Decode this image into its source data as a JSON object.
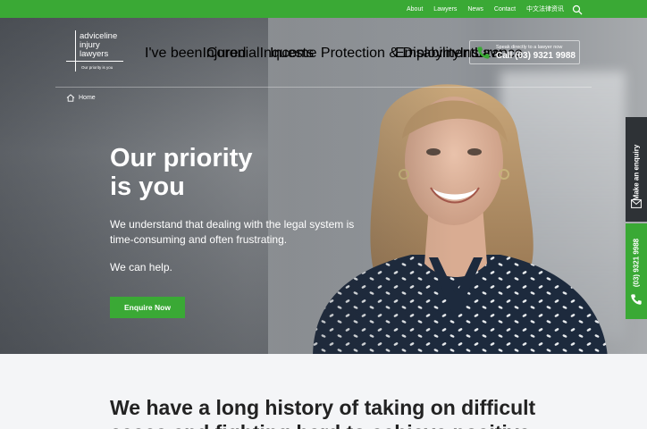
{
  "topbar": {
    "links": [
      "About",
      "Lawyers",
      "News",
      "Contact",
      "中文法律资讯"
    ],
    "search_icon": "search-icon"
  },
  "logo": {
    "line1": "adviceline",
    "line2": "injury",
    "line3": "lawyers",
    "tagline": "Our priority is you"
  },
  "nav": {
    "items": [
      {
        "line1": "I've been",
        "line2": "Injured"
      },
      {
        "line1": "Coronial",
        "line2": "Inquests"
      },
      {
        "line1": "Income Protection & Disability",
        "line2": "Insurance"
      },
      {
        "line1": "Employment",
        "line2": "Law"
      }
    ]
  },
  "call": {
    "small": "Speak directly to a lawyer now",
    "number": "Call (03) 9321 9988",
    "icon": "phone-icon"
  },
  "breadcrumb": {
    "home": "Home",
    "icon": "home-icon"
  },
  "hero": {
    "title_line1": "Our priority",
    "title_line2": "is you",
    "para1": "We understand that dealing with the legal system is time-consuming and often frustrating.",
    "para2": "We can help.",
    "cta": "Enquire Now"
  },
  "side_tabs": {
    "enquiry": "Make an enquiry",
    "phone": "(03) 9321 9988"
  },
  "lower": {
    "heading": "We have a long history of taking on difficult",
    "heading_cont": "cases and fighting hard to achieve positive"
  },
  "colors": {
    "brand_green": "#3aa935",
    "dark": "#2e3236"
  }
}
